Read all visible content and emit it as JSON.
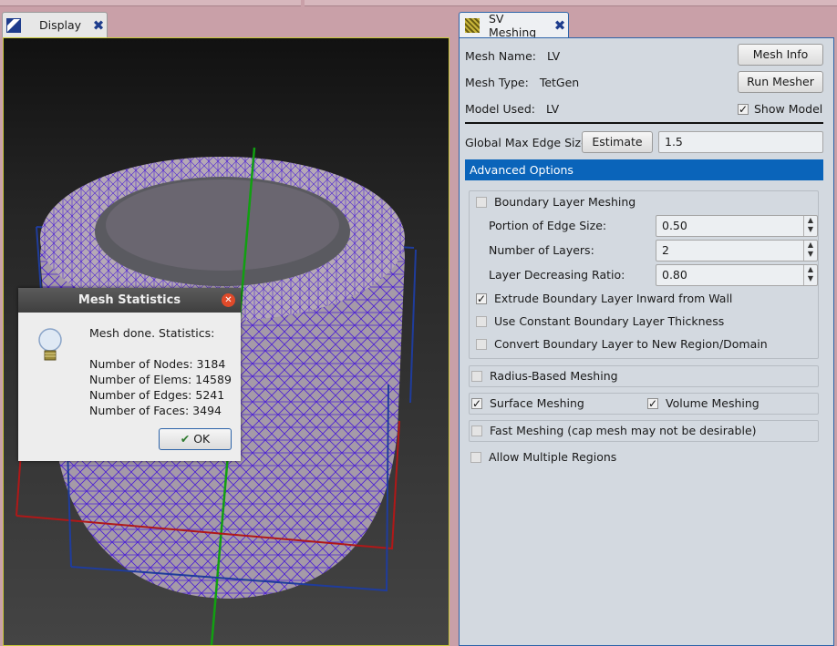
{
  "display_tab": {
    "label": "Display"
  },
  "mesh_tab": {
    "label": "SV Meshing"
  },
  "mesh": {
    "name_label": "Mesh Name:",
    "name_value": "LV",
    "type_label": "Mesh Type:",
    "type_value": "TetGen",
    "model_label": "Model Used:",
    "model_value": "LV",
    "mesh_info_button": "Mesh Info",
    "run_mesher_button": "Run Mesher",
    "show_model_label": "Show Model",
    "show_model_checked": true,
    "edge_size_label": "Global Max Edge Size:",
    "estimate_button": "Estimate",
    "edge_size_value": "1.5",
    "advanced_header": "Advanced Options"
  },
  "boundary": {
    "enabled_label": "Boundary Layer Meshing",
    "portion_label": "Portion of Edge Size:",
    "portion_value": "0.50",
    "layers_label": "Number of Layers:",
    "layers_value": "2",
    "ratio_label": "Layer Decreasing Ratio:",
    "ratio_value": "0.80",
    "extrude_label": "Extrude Boundary Layer Inward from Wall",
    "constant_label": "Use Constant Boundary Layer Thickness",
    "convert_label": "Convert Boundary Layer to New Region/Domain"
  },
  "options": {
    "radius_label": "Radius-Based Meshing",
    "surface_label": "Surface Meshing",
    "volume_label": "Volume Meshing",
    "fast_label": "Fast Meshing (cap mesh may not be desirable)",
    "multiple_label": "Allow Multiple Regions"
  },
  "dialog": {
    "title": "Mesh Statistics",
    "header": "Mesh done. Statistics:",
    "nodes": "Number of Nodes: 3184",
    "elems": "Number of Elems: 14589",
    "edges": "Number of Edges: 5241",
    "faces": "Number of Faces: 3494",
    "ok_button": "OK"
  },
  "colors": {
    "accent": "#0a64ba",
    "mesh_wire": "#4b1fd6",
    "mesh_fill": "#a59aa8"
  }
}
